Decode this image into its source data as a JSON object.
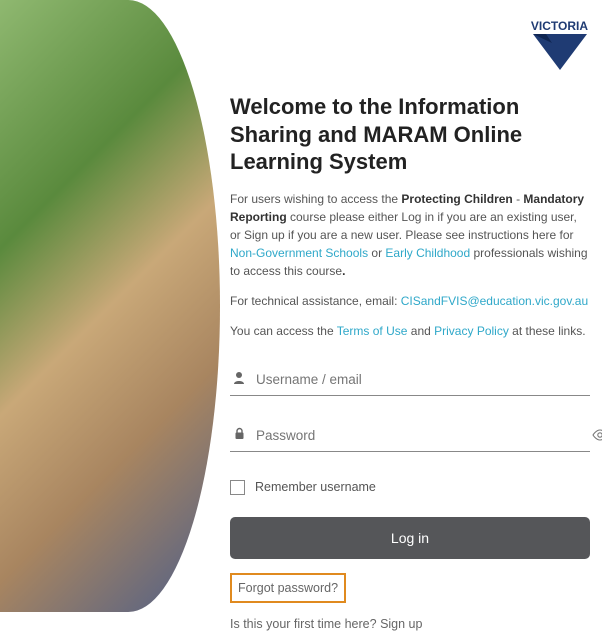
{
  "logo": {
    "text": "VICTORIA"
  },
  "heading": "Welcome to the Information Sharing and MARAM Online Learning System",
  "intro": {
    "part1": "For users wishing to access the ",
    "bold1": "Protecting Children",
    "dash": " - ",
    "bold2": "Mandatory Reporting",
    "part2": " course please either Log in if you are an existing user, or Sign up if you are a new user. Please see instructions here for ",
    "link_ngs": "Non-Government Schools",
    "part3": " or ",
    "link_ec": "Early Childhood",
    "part4": " professionals wishing to access this course",
    "dot": "."
  },
  "tech": {
    "prefix": "For technical assistance, email: ",
    "email": "CISandFVIS@education.vic.gov.au"
  },
  "access": {
    "prefix": "You can access the ",
    "tou": "Terms of Use",
    "mid": " and ",
    "pp": "Privacy Policy",
    "suffix": " at these links."
  },
  "form": {
    "username_placeholder": "Username / email",
    "password_placeholder": "Password",
    "remember_label": "Remember username",
    "login_label": "Log in",
    "forgot_label": "Forgot password?",
    "firsttime_prefix": "Is this your first time here? ",
    "signup_label": "Sign up"
  }
}
